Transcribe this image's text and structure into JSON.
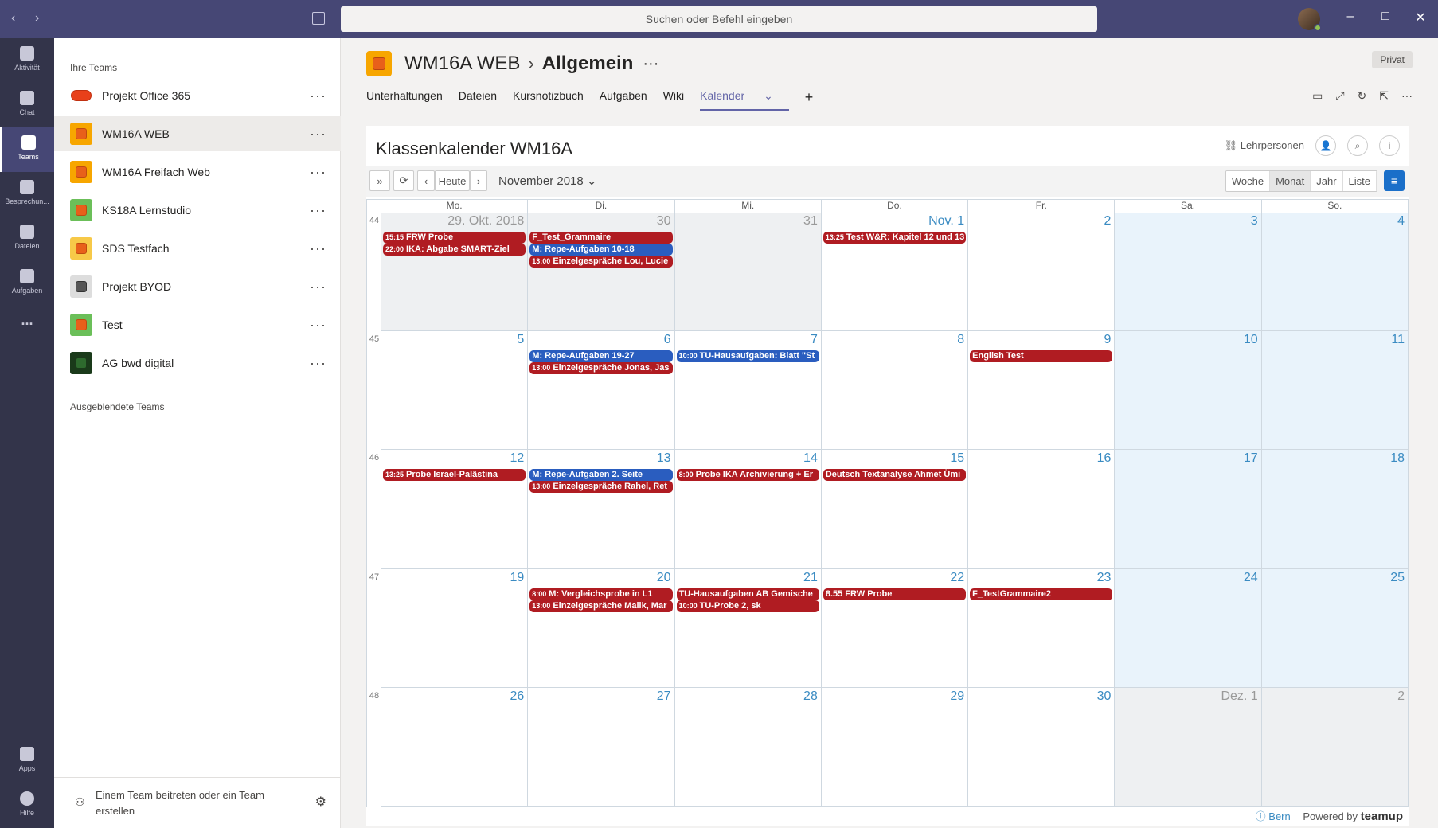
{
  "app": {
    "search_placeholder": "Suchen oder Befehl eingeben",
    "window_controls": [
      "–",
      "□",
      "✕"
    ]
  },
  "rail": [
    {
      "label": "Aktivität",
      "icon": "bell-icon"
    },
    {
      "label": "Chat",
      "icon": "chat-icon"
    },
    {
      "label": "Teams",
      "icon": "teams-icon"
    },
    {
      "label": "Besprechun...",
      "icon": "calendar-icon"
    },
    {
      "label": "Dateien",
      "icon": "files-icon"
    },
    {
      "label": "Aufgaben",
      "icon": "tasks-icon"
    },
    {
      "label": "...",
      "icon": "more-icon"
    },
    {
      "label": "Apps",
      "icon": "apps-icon"
    },
    {
      "label": "Hilfe",
      "icon": "help-icon"
    }
  ],
  "teams": {
    "heading": "Ihre Teams",
    "items": [
      {
        "name": "Projekt Office 365",
        "color": "#e8401a"
      },
      {
        "name": "WM16A WEB",
        "color": "#f7a600"
      },
      {
        "name": "WM16A Freifach Web",
        "color": "#f7a600"
      },
      {
        "name": "KS18A Lernstudio",
        "color": "#6bbf59"
      },
      {
        "name": "SDS Testfach",
        "color": "#f7c948"
      },
      {
        "name": "Projekt BYOD",
        "color": "#cccccc"
      },
      {
        "name": "Test",
        "color": "#6bbf59"
      },
      {
        "name": "AG bwd digital",
        "color": "#1a3a1a"
      }
    ],
    "hidden_heading": "Ausgeblendete Teams",
    "join_label": "Einem Team beitreten oder ein Team erstellen"
  },
  "channel": {
    "team": "WM16A WEB",
    "name": "Allgemein",
    "privacy": "Privat",
    "tabs": [
      "Unterhaltungen",
      "Dateien",
      "Kursnotizbuch",
      "Aufgaben",
      "Wiki",
      "Kalender"
    ],
    "active_tab": "Kalender"
  },
  "calendar": {
    "title": "Klassenkalender WM16A",
    "teachers_link": "Lehrpersonen",
    "today_btn": "Heute",
    "month_label": "November 2018",
    "views": [
      "Woche",
      "Monat",
      "Jahr",
      "Liste"
    ],
    "active_view": "Monat",
    "weekdays": [
      "Mo.",
      "Di.",
      "Mi.",
      "Do.",
      "Fr.",
      "Sa.",
      "So."
    ],
    "weeks": [
      {
        "num": "44",
        "days": [
          {
            "label": "29. Okt. 2018",
            "other": true,
            "events": [
              {
                "time": "15:15",
                "text": "FRW Probe",
                "color": "red"
              },
              {
                "time": "22:00",
                "text": "IKA: Abgabe SMART-Ziel",
                "color": "red"
              }
            ]
          },
          {
            "label": "30",
            "other": true,
            "events": [
              {
                "time": "",
                "text": "F_Test_Grammaire",
                "color": "red"
              },
              {
                "time": "",
                "text": "M: Repe-Aufgaben 10-18",
                "color": "blue"
              },
              {
                "time": "13:00",
                "text": "Einzelgespräche Lou, Lucie",
                "color": "red"
              }
            ]
          },
          {
            "label": "31",
            "other": true,
            "events": []
          },
          {
            "label": "Nov. 1",
            "other": false,
            "events": [
              {
                "time": "13:25",
                "text": "Test W&R: Kapitel 12 und 13",
                "color": "red"
              }
            ]
          },
          {
            "label": "2",
            "other": false,
            "events": []
          },
          {
            "label": "3",
            "other": false,
            "weekend": true,
            "events": []
          },
          {
            "label": "4",
            "other": false,
            "weekend": true,
            "events": []
          }
        ]
      },
      {
        "num": "45",
        "days": [
          {
            "label": "5",
            "events": []
          },
          {
            "label": "6",
            "events": [
              {
                "time": "",
                "text": "M: Repe-Aufgaben 19-27",
                "color": "blue"
              },
              {
                "time": "13:00",
                "text": "Einzelgespräche Jonas, Jas",
                "color": "red"
              }
            ]
          },
          {
            "label": "7",
            "events": [
              {
                "time": "10:00",
                "text": "TU-Hausaufgaben: Blatt \"St",
                "color": "blue"
              }
            ]
          },
          {
            "label": "8",
            "events": []
          },
          {
            "label": "9",
            "events": [
              {
                "time": "",
                "text": "English Test",
                "color": "red"
              }
            ]
          },
          {
            "label": "10",
            "weekend": true,
            "events": []
          },
          {
            "label": "11",
            "weekend": true,
            "events": []
          }
        ]
      },
      {
        "num": "46",
        "days": [
          {
            "label": "12",
            "events": [
              {
                "time": "13:25",
                "text": "Probe Israel-Palästina",
                "color": "red"
              }
            ]
          },
          {
            "label": "13",
            "events": [
              {
                "time": "",
                "text": "M: Repe-Aufgaben 2. Seite",
                "color": "blue"
              },
              {
                "time": "13:00",
                "text": "Einzelgespräche Rahel, Ret",
                "color": "red"
              }
            ]
          },
          {
            "label": "14",
            "events": [
              {
                "time": "8:00",
                "text": "Probe IKA Archivierung + Er",
                "color": "red"
              }
            ]
          },
          {
            "label": "15",
            "events": [
              {
                "time": "",
                "text": "Deutsch Textanalyse Ahmet Ümi",
                "color": "red"
              }
            ]
          },
          {
            "label": "16",
            "events": []
          },
          {
            "label": "17",
            "weekend": true,
            "events": []
          },
          {
            "label": "18",
            "weekend": true,
            "events": []
          }
        ]
      },
      {
        "num": "47",
        "days": [
          {
            "label": "19",
            "events": []
          },
          {
            "label": "20",
            "events": [
              {
                "time": "8:00",
                "text": "M: Vergleichsprobe in L1",
                "color": "red"
              },
              {
                "time": "13:00",
                "text": "Einzelgespräche Malik, Mar",
                "color": "red"
              }
            ]
          },
          {
            "label": "21",
            "events": [
              {
                "time": "",
                "text": "TU-Hausaufgaben AB Gemische",
                "color": "red"
              },
              {
                "time": "10:00",
                "text": "TU-Probe 2, sk",
                "color": "red"
              }
            ]
          },
          {
            "label": "22",
            "events": [
              {
                "time": "",
                "text": "8.55 FRW Probe",
                "color": "red"
              }
            ]
          },
          {
            "label": "23",
            "events": [
              {
                "time": "",
                "text": "F_TestGrammaire2",
                "color": "red"
              }
            ]
          },
          {
            "label": "24",
            "weekend": true,
            "events": []
          },
          {
            "label": "25",
            "weekend": true,
            "events": []
          }
        ]
      },
      {
        "num": "48",
        "days": [
          {
            "label": "26",
            "events": []
          },
          {
            "label": "27",
            "events": []
          },
          {
            "label": "28",
            "events": []
          },
          {
            "label": "29",
            "events": []
          },
          {
            "label": "30",
            "events": []
          },
          {
            "label": "Dez. 1",
            "other": true,
            "events": []
          },
          {
            "label": "2",
            "other": true,
            "events": []
          }
        ]
      }
    ],
    "footer_location": "Bern",
    "footer_powered": "Powered by",
    "footer_brand": "teamup"
  }
}
